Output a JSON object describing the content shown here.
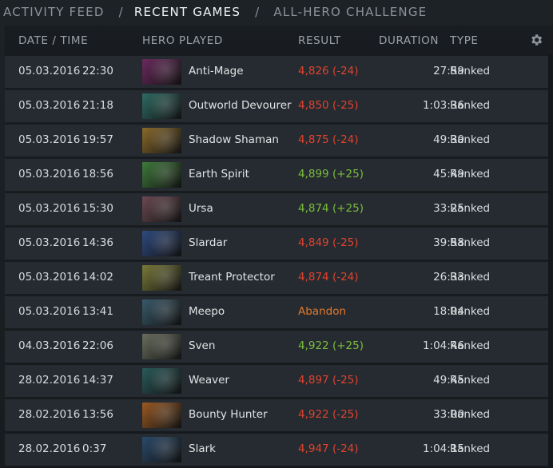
{
  "breadcrumb": {
    "items": [
      "ACTIVITY FEED",
      "RECENT GAMES",
      "ALL-HERO CHALLENGE"
    ],
    "separator": "/"
  },
  "table": {
    "columns": {
      "date": "DATE / TIME",
      "hero": "HERO PLAYED",
      "result": "RESULT",
      "duration": "DURATION",
      "type": "TYPE"
    },
    "settings_icon": "gear-icon",
    "rows": [
      {
        "date": "05.03.2016",
        "time": "22:30",
        "hero": "Anti-Mage",
        "result": "4,826 (-24)",
        "status": "loss",
        "duration": "27:59",
        "type": "Ranked",
        "color": "#6b2a5e"
      },
      {
        "date": "05.03.2016",
        "time": "21:18",
        "hero": "Outworld Devourer",
        "result": "4,850 (-25)",
        "status": "loss",
        "duration": "1:03:36",
        "type": "Ranked",
        "color": "#2f6b63"
      },
      {
        "date": "05.03.2016",
        "time": "19:57",
        "hero": "Shadow Shaman",
        "result": "4,875 (-24)",
        "status": "loss",
        "duration": "49:30",
        "type": "Ranked",
        "color": "#8a6a2a"
      },
      {
        "date": "05.03.2016",
        "time": "18:56",
        "hero": "Earth Spirit",
        "result": "4,899 (+25)",
        "status": "win",
        "duration": "45:49",
        "type": "Ranked",
        "color": "#3f7a3a"
      },
      {
        "date": "05.03.2016",
        "time": "15:30",
        "hero": "Ursa",
        "result": "4,874 (+25)",
        "status": "win",
        "duration": "33:25",
        "type": "Ranked",
        "color": "#6b4a52"
      },
      {
        "date": "05.03.2016",
        "time": "14:36",
        "hero": "Slardar",
        "result": "4,849 (-25)",
        "status": "loss",
        "duration": "39:58",
        "type": "Ranked",
        "color": "#2f4a80"
      },
      {
        "date": "05.03.2016",
        "time": "14:02",
        "hero": "Treant Protector",
        "result": "4,874 (-24)",
        "status": "loss",
        "duration": "26:33",
        "type": "Ranked",
        "color": "#7a7a3a"
      },
      {
        "date": "05.03.2016",
        "time": "13:41",
        "hero": "Meepo",
        "result": "Abandon",
        "status": "abandon",
        "duration": "18:04",
        "type": "Ranked",
        "color": "#3a5a6a"
      },
      {
        "date": "04.03.2016",
        "time": "22:06",
        "hero": "Sven",
        "result": "4,922 (+25)",
        "status": "win",
        "duration": "1:04:46",
        "type": "Ranked",
        "color": "#6a6e5e"
      },
      {
        "date": "28.02.2016",
        "time": "14:37",
        "hero": "Weaver",
        "result": "4,897 (-25)",
        "status": "loss",
        "duration": "49:45",
        "type": "Ranked",
        "color": "#2a5a5a"
      },
      {
        "date": "28.02.2016",
        "time": "13:56",
        "hero": "Bounty Hunter",
        "result": "4,922 (-25)",
        "status": "loss",
        "duration": "33:00",
        "type": "Ranked",
        "color": "#9a5a22"
      },
      {
        "date": "28.02.2016",
        "time": "0:37",
        "hero": "Slark",
        "result": "4,947 (-24)",
        "status": "loss",
        "duration": "1:04:15",
        "type": "Ranked",
        "color": "#2a4a6a"
      }
    ]
  }
}
